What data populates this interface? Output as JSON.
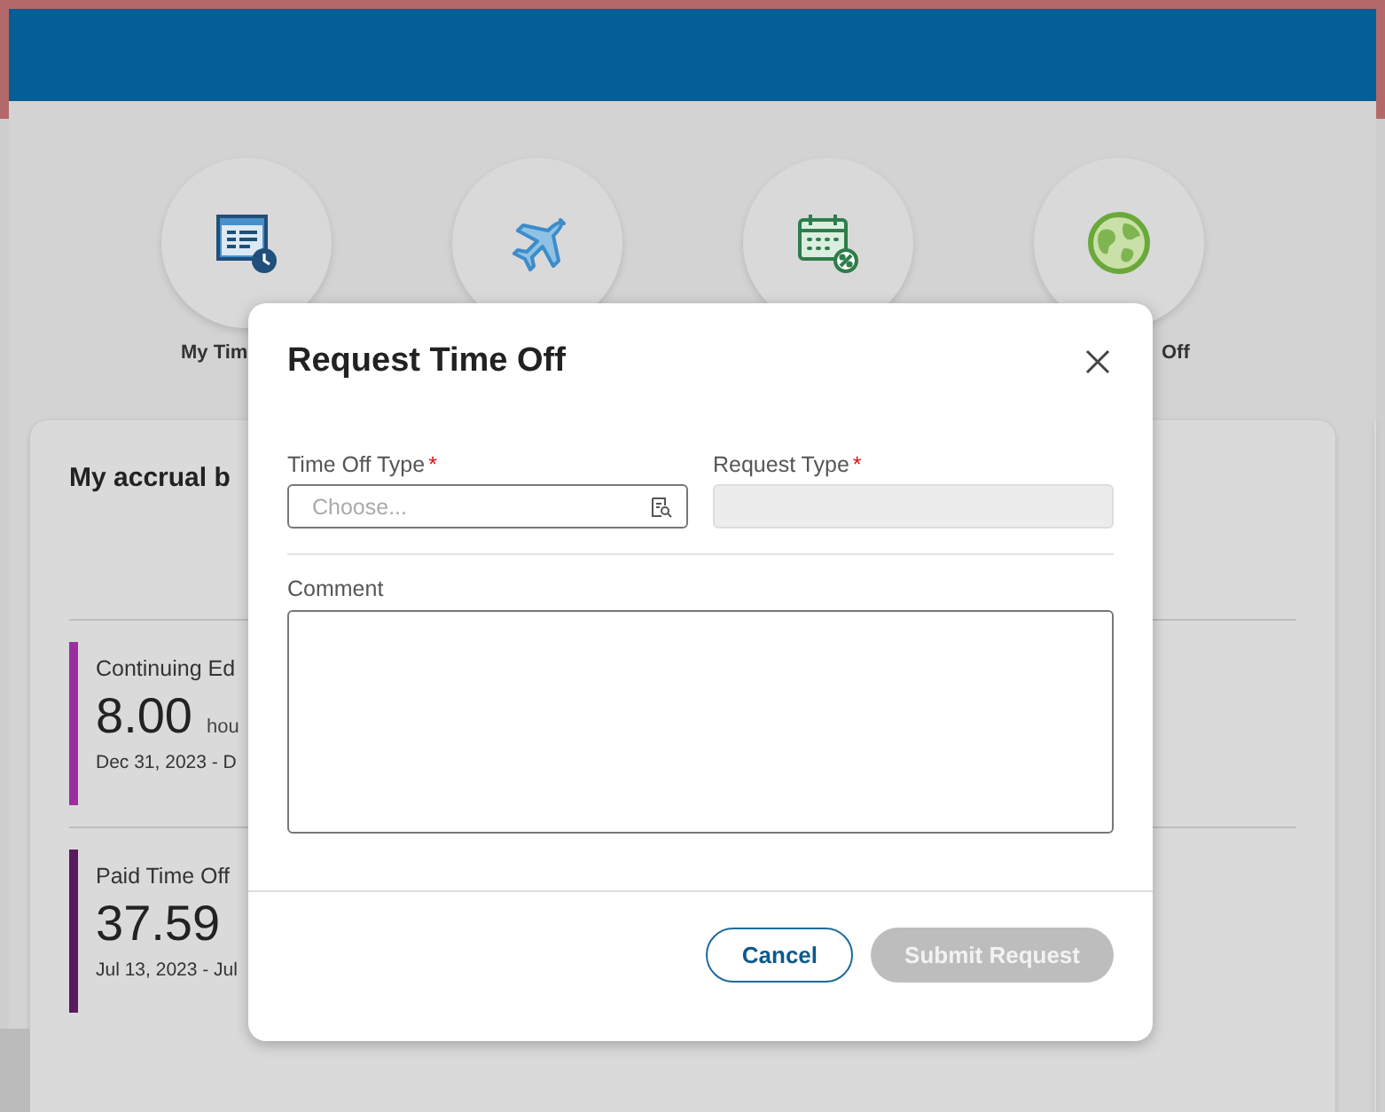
{
  "shortcuts": [
    {
      "kind": "timesheet",
      "label": "My Tim"
    },
    {
      "kind": "plane"
    },
    {
      "kind": "calendar"
    },
    {
      "kind": "globe",
      "label": "Off"
    }
  ],
  "accruals": {
    "title": "My accrual b",
    "items": [
      {
        "name": "Continuing Ed",
        "amount": "8.00",
        "unit": "hou",
        "dates": "Dec 31, 2023 - D",
        "color": "#9b2fa0"
      },
      {
        "name": "Paid Time Off",
        "amount": "37.59",
        "dates": "Jul 13, 2023 - Jul",
        "color": "#5a1a5e"
      }
    ]
  },
  "dialog": {
    "title": "Request Time Off",
    "fields": [
      {
        "label": "Time Off Type",
        "required_mark": "*",
        "placeholder": "Choose...",
        "disabled": false
      },
      {
        "label": "Request Type",
        "required_mark": "*",
        "disabled": true
      }
    ],
    "comment": {
      "label": "Comment"
    },
    "buttons": [
      {
        "label": "Cancel",
        "kind": "secondary",
        "disabled": false
      },
      {
        "label": "Submit Request",
        "kind": "primary",
        "disabled": true
      }
    ]
  }
}
